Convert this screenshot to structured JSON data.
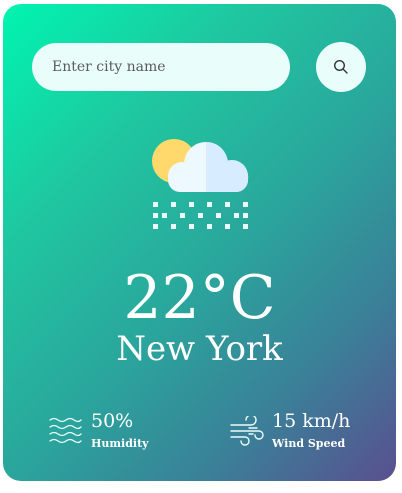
{
  "search": {
    "placeholder": "Enter city name",
    "value": ""
  },
  "weather": {
    "condition_icon": "snow-cloud-sun-icon",
    "temperature": "22°C",
    "city": "New York"
  },
  "details": {
    "humidity": {
      "value": "50%",
      "label": "Humidity",
      "icon": "waves-icon"
    },
    "wind": {
      "value": "15 km/h",
      "label": "Wind Speed",
      "icon": "wind-icon"
    }
  },
  "colors": {
    "gradient_start": "#00f5b0",
    "gradient_end": "#5a4f8f",
    "input_background": "#e9fdfa",
    "sun": "#ffd96b",
    "cloud": "#eef8ff"
  }
}
